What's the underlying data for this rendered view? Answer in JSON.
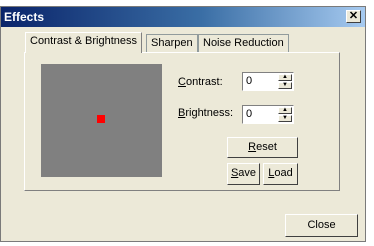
{
  "window": {
    "title": "Effects",
    "close_glyph": "✕"
  },
  "tabs": [
    {
      "label": "Contrast & Brightness",
      "active": true
    },
    {
      "label": "Sharpen",
      "active": false
    },
    {
      "label": "Noise Reduction",
      "active": false
    }
  ],
  "preview": {
    "background": "#808080",
    "marker_color": "#ff0000"
  },
  "contrast": {
    "label_accel": "C",
    "label_rest": "ontrast:",
    "value": "0"
  },
  "brightness": {
    "label_accel": "B",
    "label_rest": "rightness:",
    "value": "0"
  },
  "buttons": {
    "reset": {
      "accel": "R",
      "rest": "eset"
    },
    "save": {
      "accel": "S",
      "rest": "ave"
    },
    "load": {
      "accel": "L",
      "rest": "oad"
    },
    "close": {
      "label": "Close"
    }
  },
  "spin_arrows": {
    "up": "▲",
    "down": "▼"
  }
}
